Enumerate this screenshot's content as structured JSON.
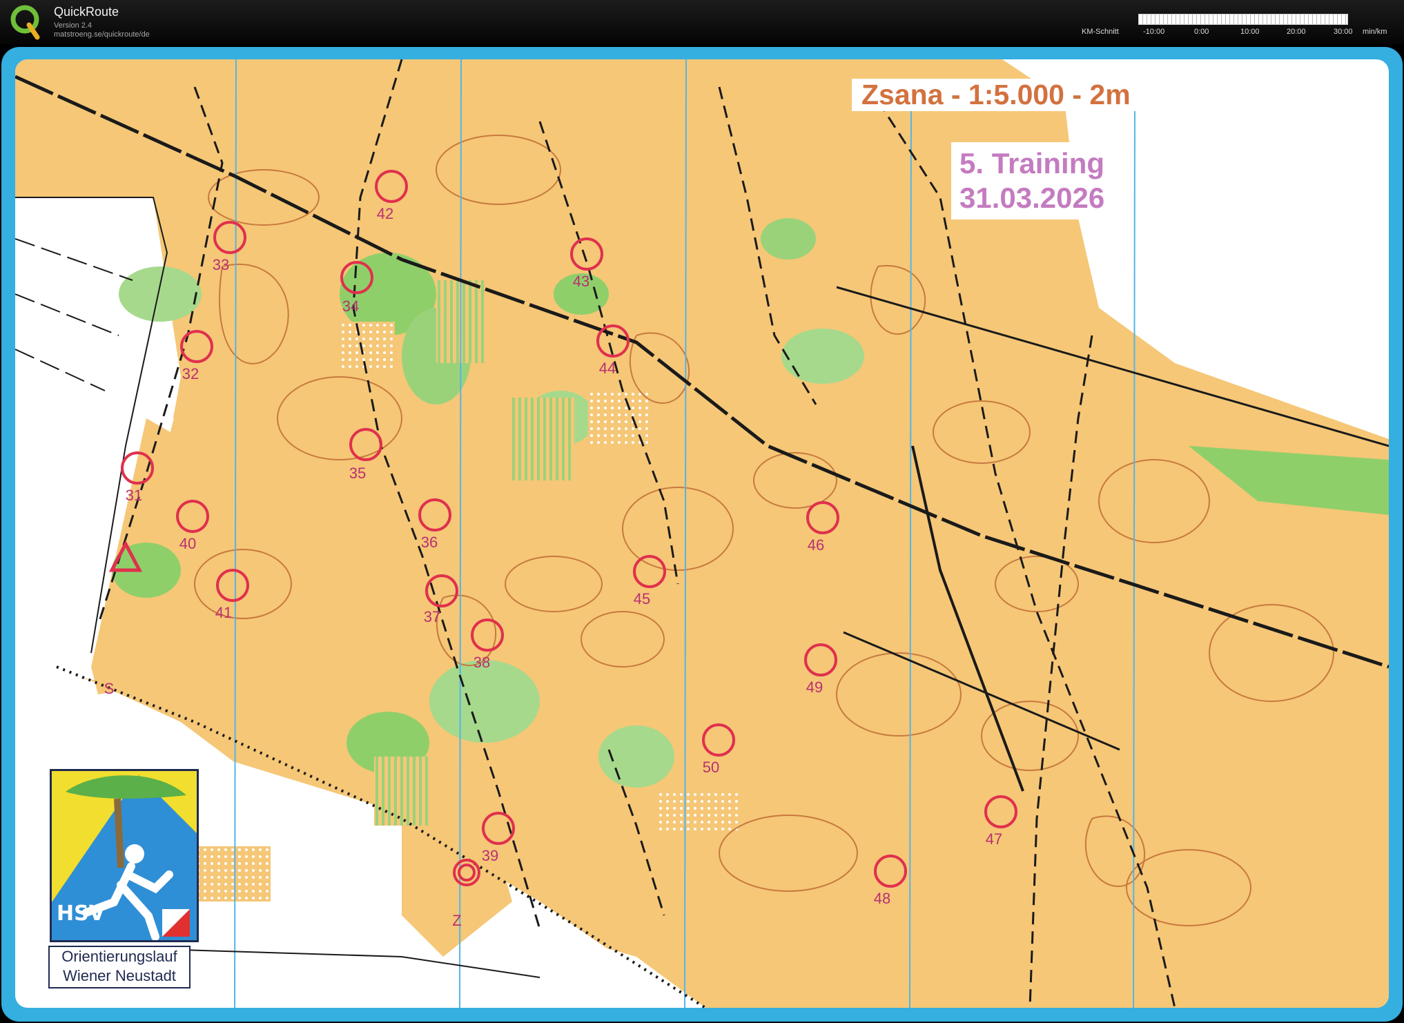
{
  "app": {
    "title": "QuickRoute",
    "version": "Version 2.4",
    "url": "matstroeng.se/quickroute/de",
    "logo_letter": "Q"
  },
  "pace_legend": {
    "label": "KM-Schnitt",
    "ticks": [
      "-10:00",
      "0:00",
      "10:00",
      "20:00",
      "30:00"
    ],
    "unit": "min/km"
  },
  "map": {
    "scale_title": "Zsana - 1:5.000 - 2m",
    "event_line1": "5. Training",
    "event_line2": "31.03.2026",
    "start_label": "S",
    "finish_label": "Z",
    "controls": [
      "31",
      "32",
      "33",
      "34",
      "35",
      "36",
      "37",
      "38",
      "39",
      "40",
      "41",
      "42",
      "43",
      "44",
      "45",
      "46",
      "47",
      "48",
      "49",
      "50"
    ],
    "colors": {
      "terrain": "#f5c777",
      "vegetation": "#8fcf6a",
      "contour": "#c8793e",
      "control": "#e0304d",
      "label": "#bb2f6f",
      "frame": "#35aee0"
    }
  },
  "club": {
    "abbr": "HSV",
    "line1": "Orientierungslauf",
    "line2": "Wiener Neustadt"
  }
}
